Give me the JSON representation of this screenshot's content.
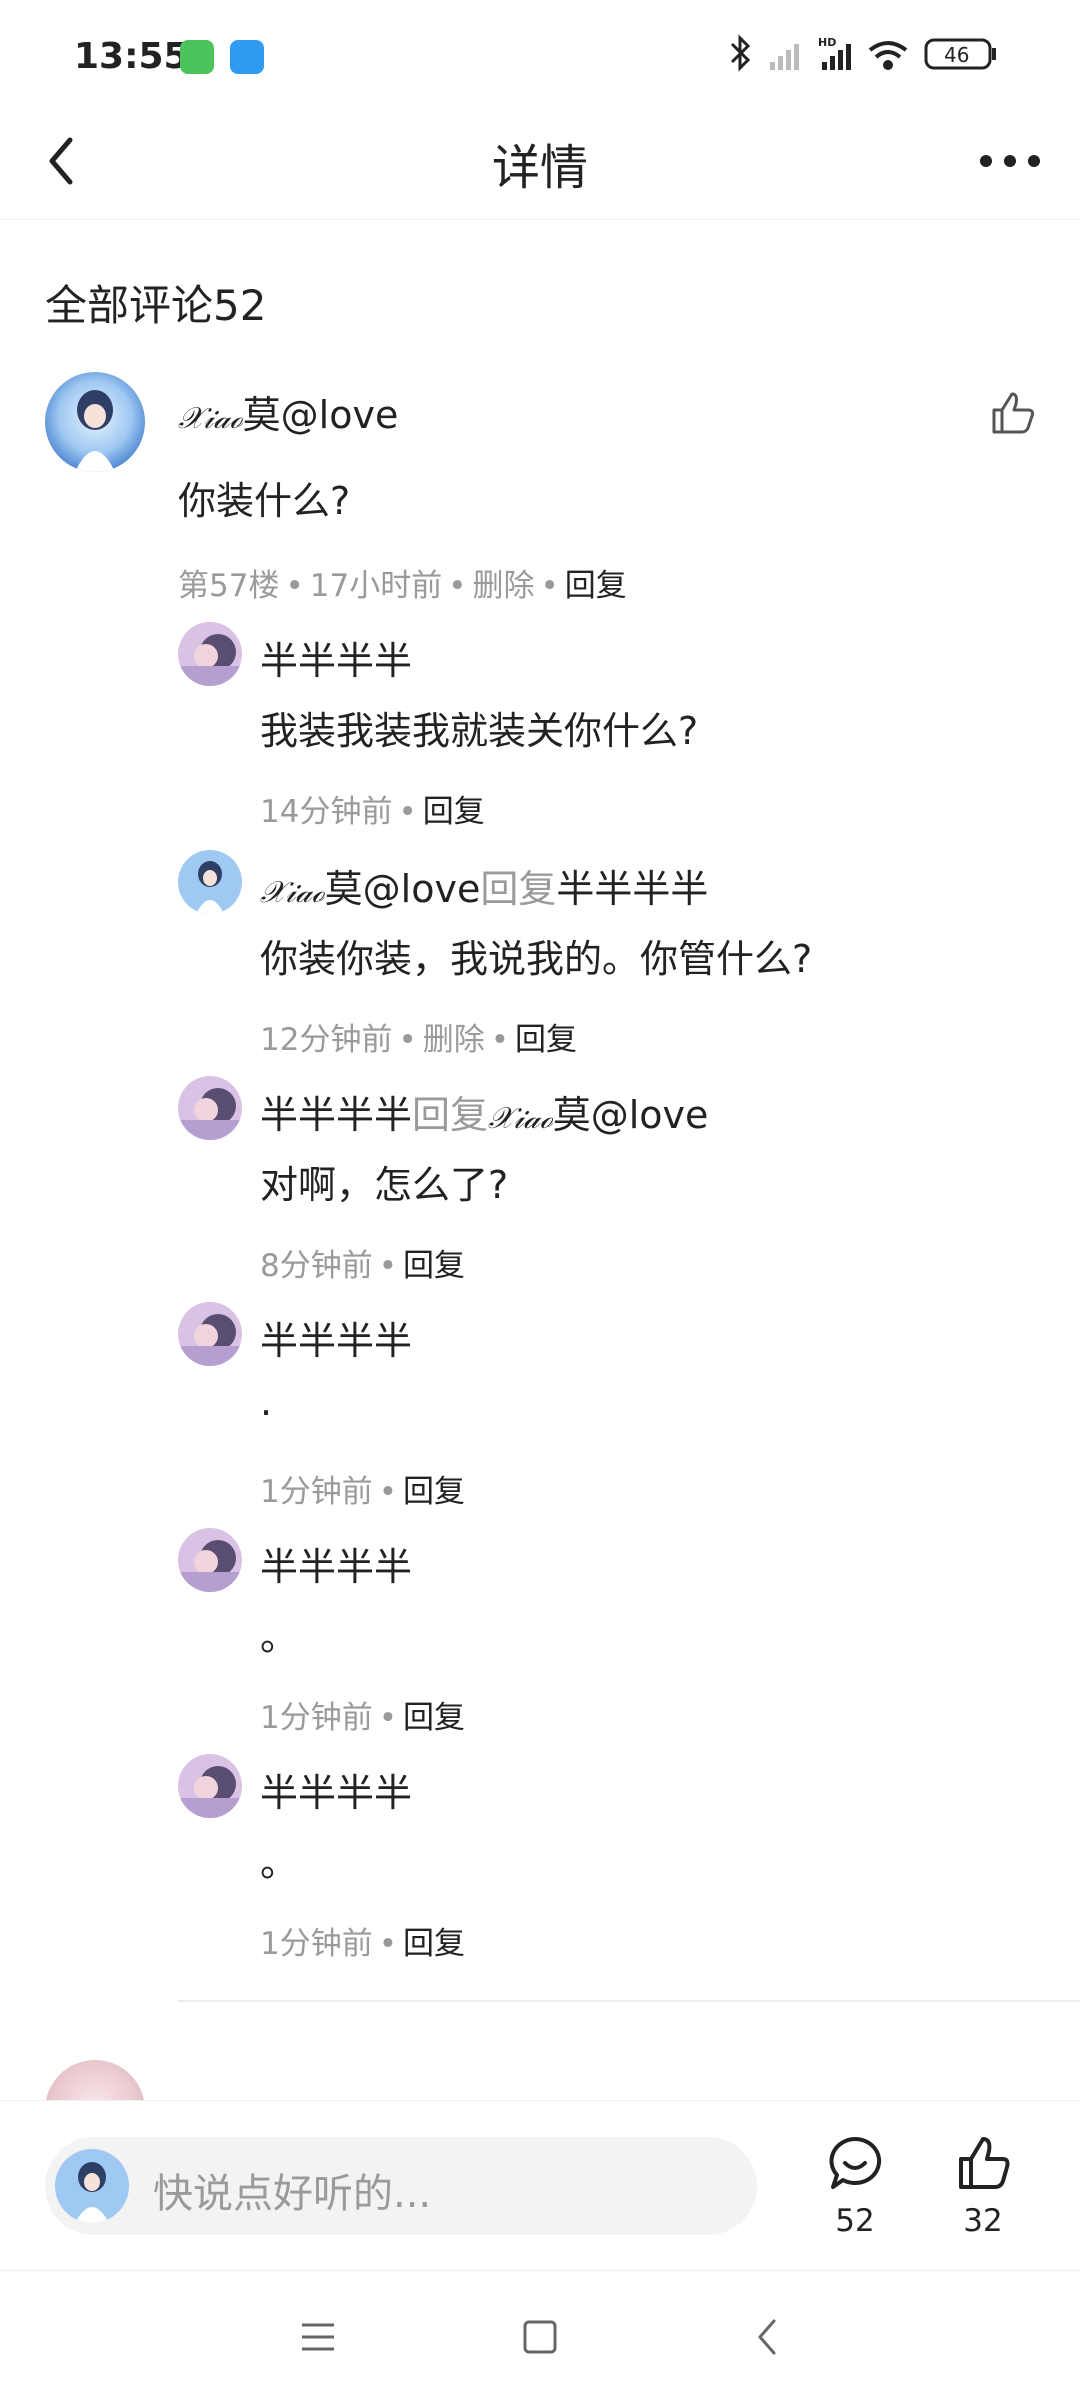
{
  "status_bar": {
    "time": "13:55",
    "battery": "46"
  },
  "header": {
    "title": "详情"
  },
  "comments_header": {
    "title": "全部评论52"
  },
  "main_comment": {
    "user_script": "𝒳𝒾𝒶ℴ",
    "user_rest": "莫@love",
    "text": "你装什么?",
    "floor": "第57楼",
    "time": "17小时前",
    "delete_label": "删除",
    "reply_label": "回复"
  },
  "replies": [
    {
      "name": "半半半半",
      "text": "我装我装我就装关你什么?",
      "time": "14分钟前",
      "reply_label": "回复"
    },
    {
      "name_script": "𝒳𝒾𝒶ℴ",
      "name_rest": "莫@love",
      "reply_word": "回复",
      "target": "半半半半",
      "text": "你装你装，我说我的。你管什么?",
      "time": "12分钟前",
      "delete_label": "删除",
      "reply_label": "回复"
    },
    {
      "name": "半半半半",
      "reply_word": "回复",
      "target_script": "𝒳𝒾𝒶ℴ",
      "target_rest": "莫@love",
      "text": "对啊，怎么了?",
      "time": "8分钟前",
      "reply_label": "回复"
    },
    {
      "name": "半半半半",
      "text": ".",
      "time": "1分钟前",
      "reply_label": "回复"
    },
    {
      "name": "半半半半",
      "text": "。",
      "time": "1分钟前",
      "reply_label": "回复"
    },
    {
      "name": "半半半半",
      "text": "。",
      "time": "1分钟前",
      "reply_label": "回复"
    }
  ],
  "bottom_bar": {
    "input_placeholder": "快说点好听的...",
    "comment_count": "52",
    "like_count": "32"
  },
  "colors": {
    "accent_text": "#222222",
    "muted_text": "#9a9a9a",
    "background": "#ffffff",
    "input_bg": "#f3f3f3"
  }
}
